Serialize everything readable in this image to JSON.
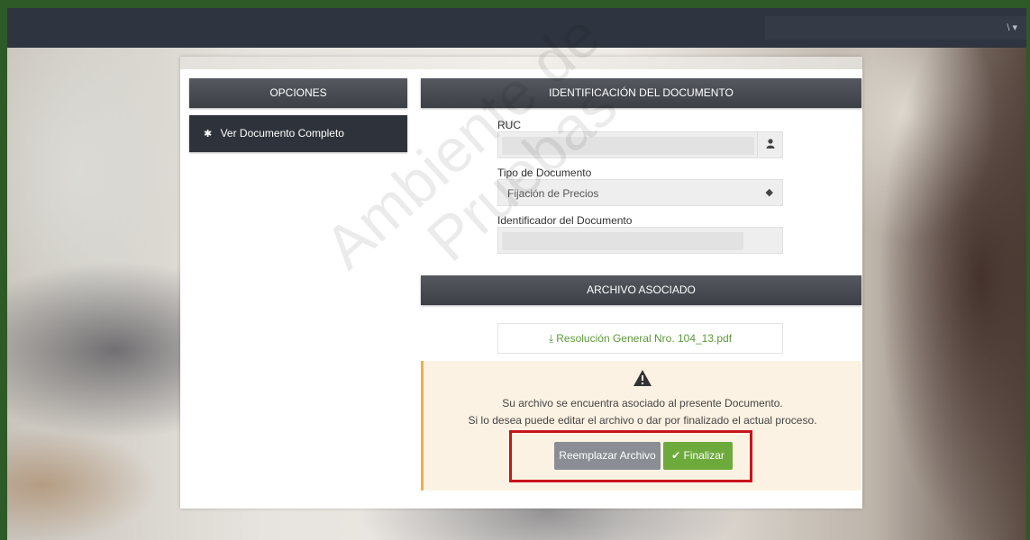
{
  "topbar": {
    "user_menu": "\\ ▾"
  },
  "options": {
    "header": "OPCIONES",
    "items": [
      {
        "label": "Ver Documento Completo",
        "icon": "gear-icon"
      }
    ]
  },
  "document": {
    "header": "IDENTIFICACIÓN DEL DOCUMENTO",
    "ruc_label": "RUC",
    "ruc_value": "",
    "ruc_icon": "user-icon",
    "tipo_label": "Tipo de Documento",
    "tipo_value": "Fijación de Precios",
    "identificador_label": "Identificador del Documento",
    "identificador_value": ""
  },
  "archivo": {
    "header": "ARCHIVO ASOCIADO",
    "file_name": "Resolución General Nro. 104_13.pdf",
    "notice_line1": "Su archivo se encuentra asociado al presente Documento.",
    "notice_line2": "Si lo desea puede editar el archivo o dar por finalizado el actual proceso.",
    "replace_label": "Reemplazar Archivo",
    "finish_label": "Finalizar"
  },
  "watermark": {
    "line1": "Ambiente de",
    "line2": "Pruebas"
  },
  "colors": {
    "accent_green": "#6daa3c",
    "highlight_red": "#c8141c",
    "notice_bg": "#fcf2e3"
  }
}
